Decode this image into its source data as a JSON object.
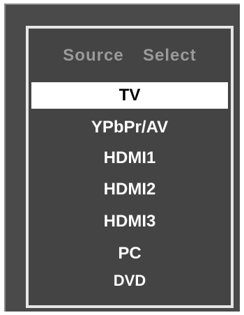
{
  "menu": {
    "title": "Source  Select",
    "items": [
      {
        "label": "TV",
        "selected": true
      },
      {
        "label": "YPbPr/AV",
        "selected": false
      },
      {
        "label": "HDMI1",
        "selected": false
      },
      {
        "label": "HDMI2",
        "selected": false
      },
      {
        "label": "HDMI3",
        "selected": false
      },
      {
        "label": "PC",
        "selected": false
      },
      {
        "label": "DVD",
        "selected": false
      }
    ]
  },
  "colors": {
    "background": "#4a4a4a",
    "frame": "#e6e6e6",
    "title": "#9a9a9a",
    "item_text": "#ffffff",
    "selected_bg": "#ffffff",
    "selected_text": "#000000"
  }
}
